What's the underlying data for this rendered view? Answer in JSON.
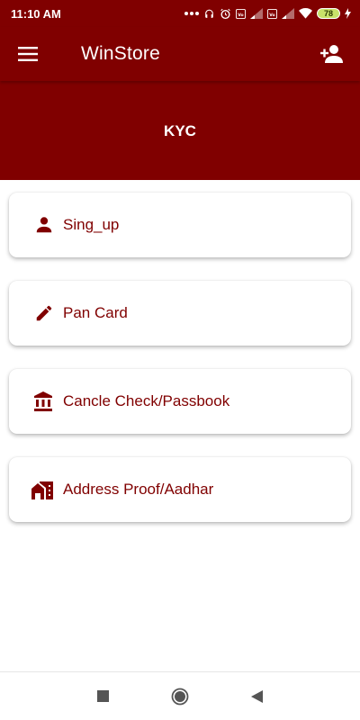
{
  "status_bar": {
    "time": "11:10 AM",
    "indicators": [
      "dots-icon",
      "headset-icon",
      "alarm-icon",
      "volte-icon",
      "signal-icon",
      "volte-icon",
      "signal-icon",
      "wifi-icon"
    ],
    "battery": "78"
  },
  "app_bar": {
    "title": "WinStore",
    "menu_icon": "menu-icon",
    "action_icon": "person-add-icon"
  },
  "banner": {
    "title": "KYC"
  },
  "cards": [
    {
      "label": "Sing_up",
      "icon": "person-icon"
    },
    {
      "label": "Pan Card",
      "icon": "pencil-icon"
    },
    {
      "label": "Cancle Check/Passbook",
      "icon": "bank-icon"
    },
    {
      "label": "Address Proof/Aadhar",
      "icon": "home-work-icon"
    }
  ],
  "nav_bar": {
    "buttons": [
      "recents-icon",
      "home-icon",
      "back-icon"
    ]
  },
  "colors": {
    "primary": "#800000",
    "surface": "#ffffff"
  }
}
